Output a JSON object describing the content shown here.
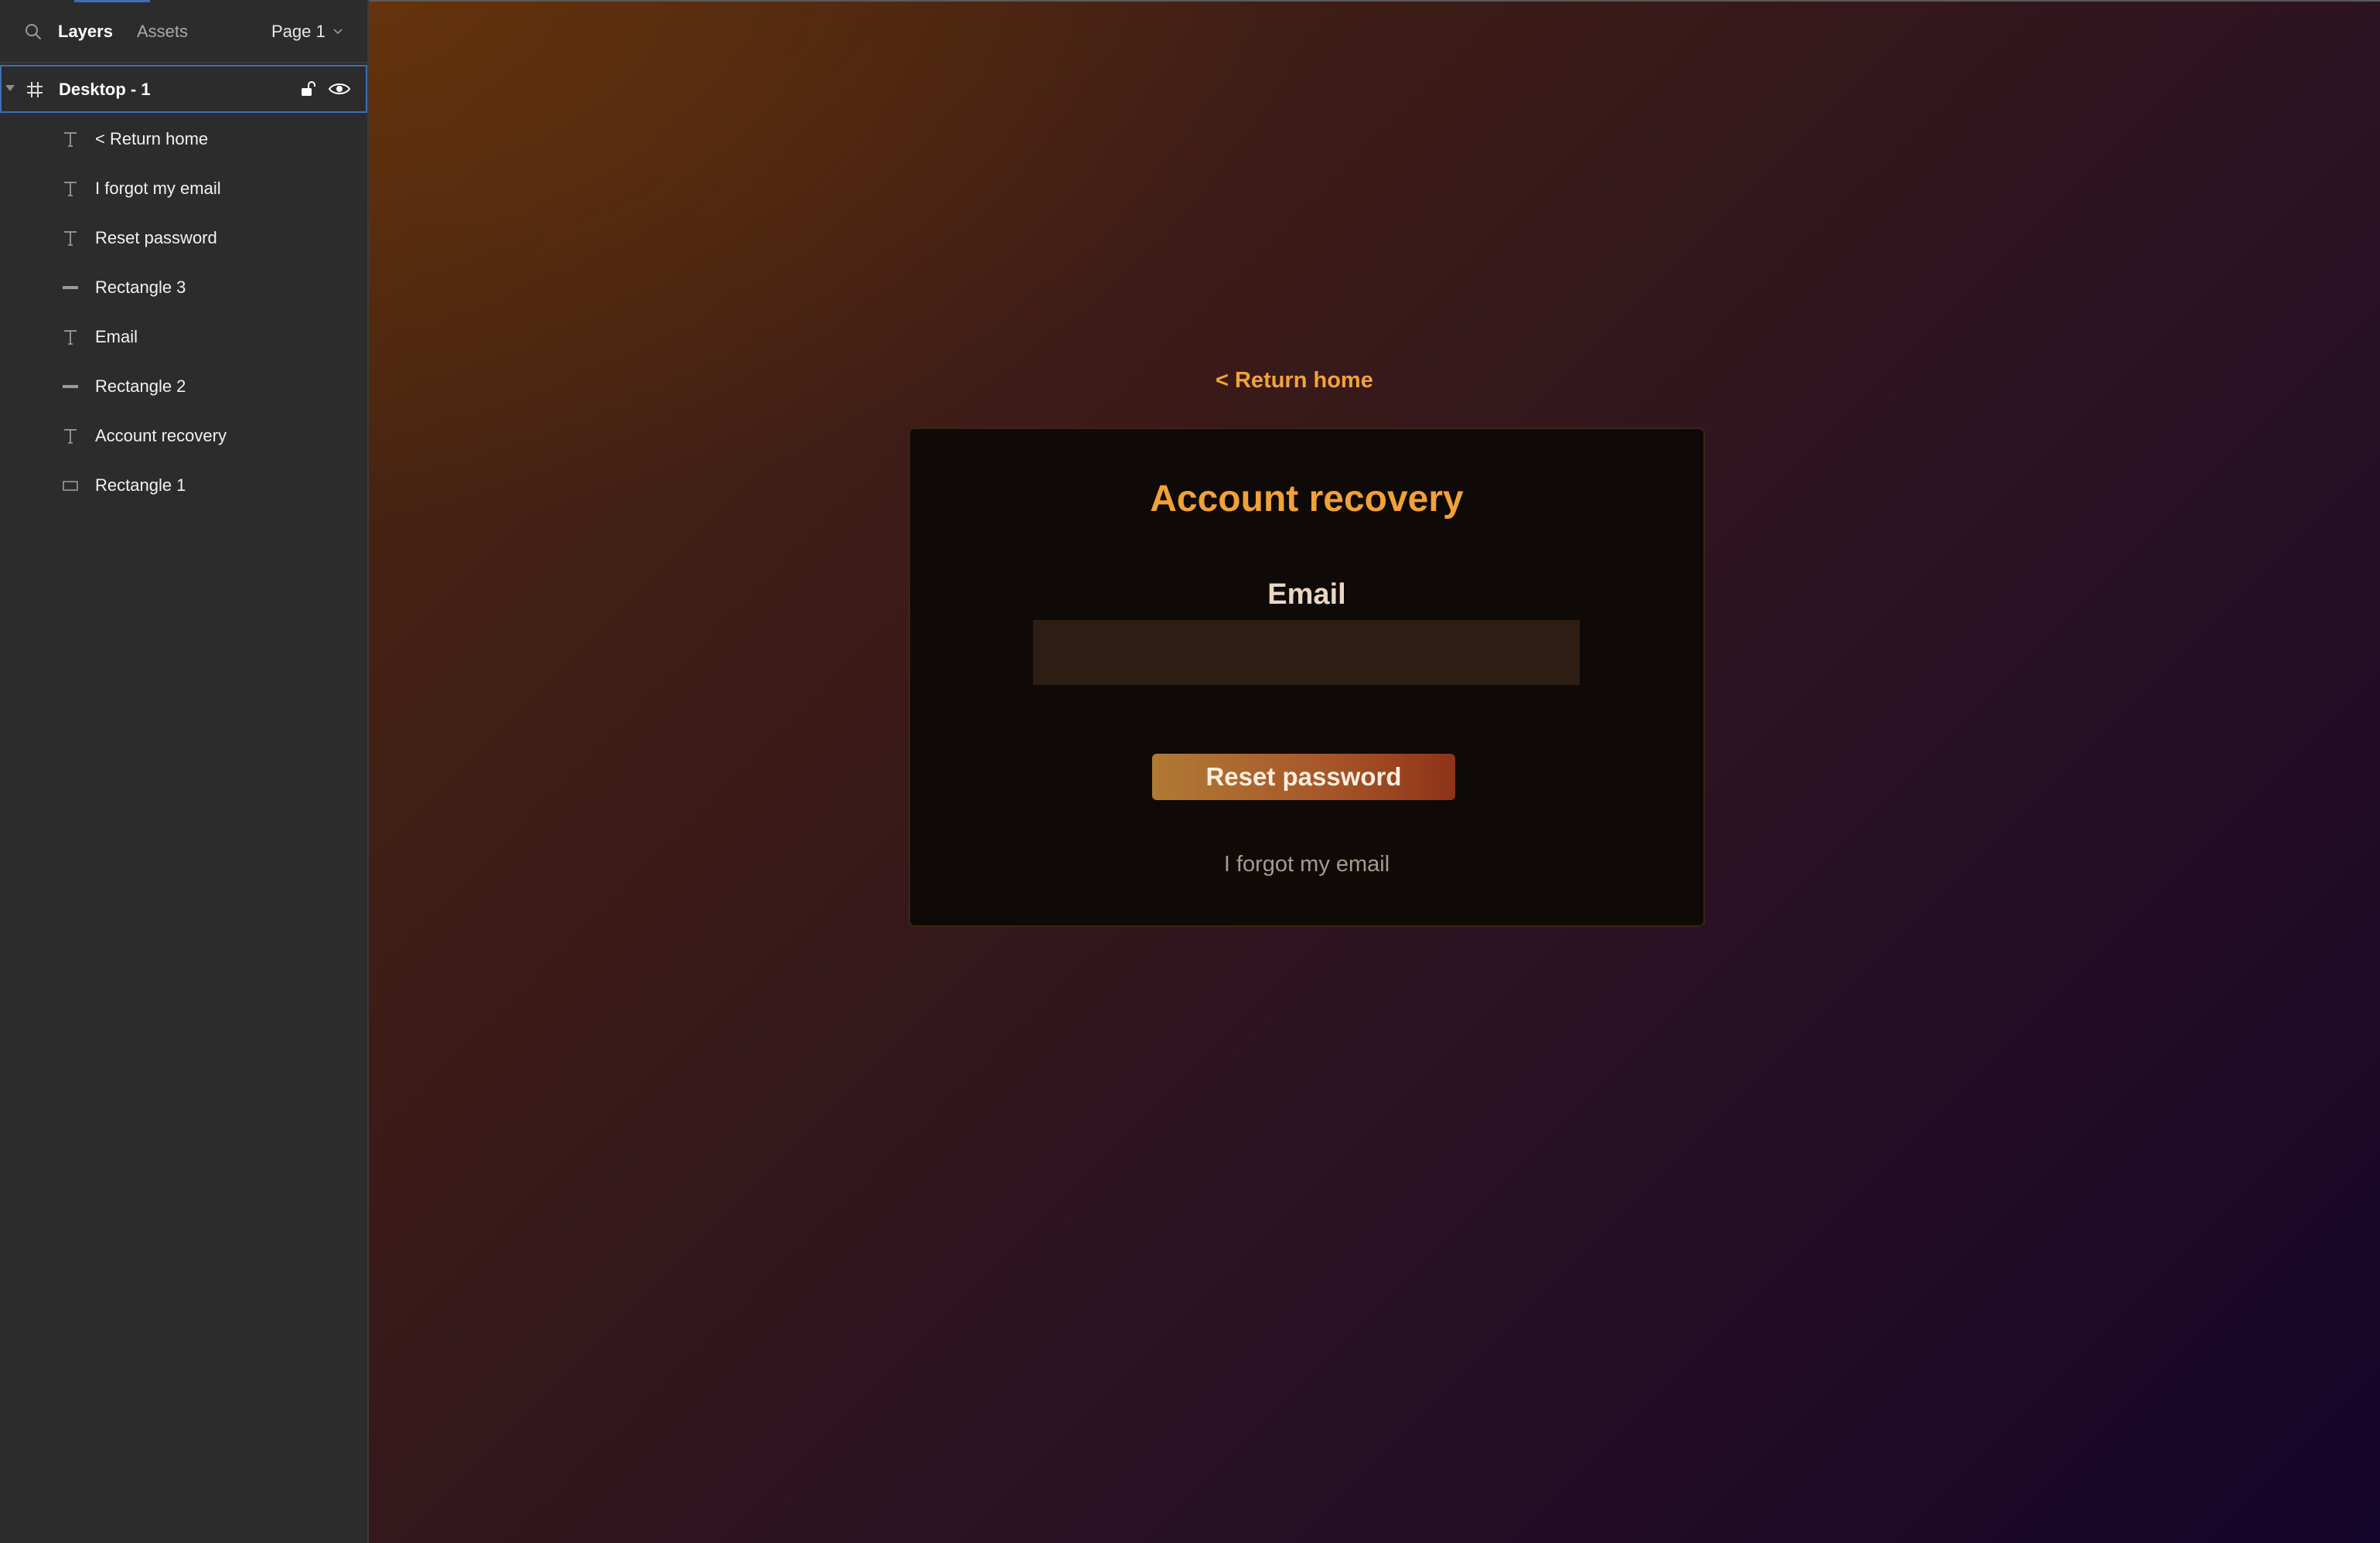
{
  "panel": {
    "tabs": [
      {
        "label": "Layers",
        "active": true
      },
      {
        "label": "Assets",
        "active": false
      }
    ],
    "page_selector": {
      "value": "Page 1"
    },
    "frame": {
      "label": "Desktop - 1",
      "icon": "frame-hash-icon",
      "selected": true
    },
    "layers": [
      {
        "label": "< Return home",
        "icon": "text-icon"
      },
      {
        "label": "I forgot my email",
        "icon": "text-icon"
      },
      {
        "label": "Reset password",
        "icon": "text-icon"
      },
      {
        "label": "Rectangle 3",
        "icon": "line-icon"
      },
      {
        "label": "Email",
        "icon": "text-icon"
      },
      {
        "label": "Rectangle 2",
        "icon": "line-icon"
      },
      {
        "label": "Account recovery",
        "icon": "text-icon"
      },
      {
        "label": "Rectangle 1",
        "icon": "rectangle-icon"
      }
    ]
  },
  "canvas": {
    "return_link": "< Return home",
    "card": {
      "title": "Account recovery",
      "email_label": "Email",
      "email_value": "",
      "email_placeholder": "",
      "button_label": "Reset password",
      "forgot_link": "I forgot my email"
    }
  },
  "colors": {
    "accent_orange": "#f0a13a",
    "selection_blue": "#3d6fb8",
    "card_background": "#0f0a08",
    "input_background": "#2e1d12",
    "panel_background": "#2c2c2c"
  }
}
